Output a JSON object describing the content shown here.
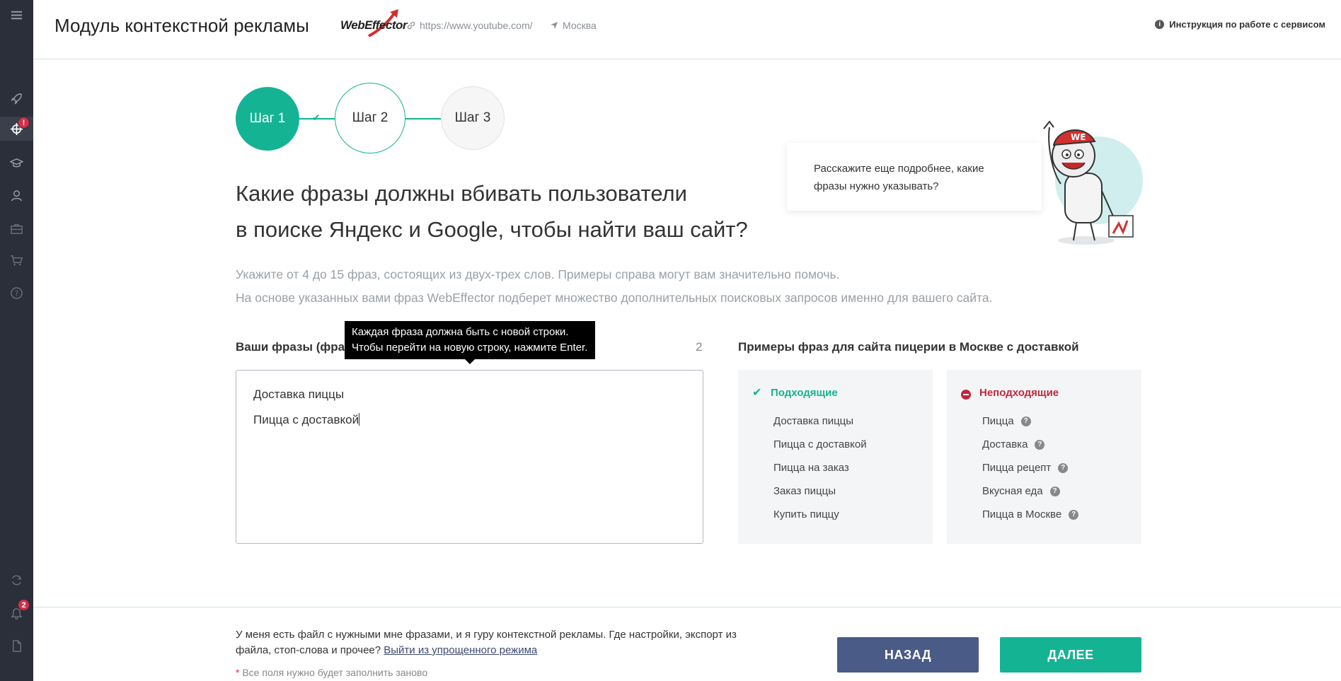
{
  "header": {
    "title": "Модуль контекстной рекламы",
    "logo_text": "WebEffector",
    "url": "https://www.youtube.com/",
    "region": "Москва",
    "instruction": "Инструкция по работе с сервисом"
  },
  "sidebar": {
    "targets_badge": "!",
    "notifications_badge": "2"
  },
  "steps": [
    "Шаг 1",
    "Шаг 2",
    "Шаг 3"
  ],
  "question": {
    "line1": "Какие фразы должны вбивать пользователи",
    "line2": "в поиске Яндекс и Google, чтобы найти ваш сайт?"
  },
  "hint": {
    "line1": "Укажите от 4 до 15 фраз, состоящих из двух-трех слов. Примеры справа могут вам значительно помочь.",
    "line2": "На основе указанных вами фраз WebEffector подберет множество дополнительных поисковых запросов именно для вашего сайта."
  },
  "bubble_text": "Расскажите еще подробнее, какие фразы нужно указывать?",
  "phrases": {
    "label": "Ваши фразы (фраз",
    "count": "2",
    "lines": [
      "Доставка пиццы",
      "Пицца с доставкой"
    ],
    "tooltip_line1": "Каждая фраза должна быть с новой строки.",
    "tooltip_line2": "Чтобы перейти на новую строку, нажмите Enter."
  },
  "examples": {
    "label": "Примеры фраз для сайта пицерии в Москве с доставкой",
    "good_title": "Подходящие",
    "good": [
      "Доставка пиццы",
      "Пицца с доставкой",
      "Пицца на заказ",
      "Заказ пиццы",
      "Купить пиццу"
    ],
    "bad_title": "Неподходящие",
    "bad": [
      "Пицца",
      "Доставка",
      "Пицца рецепт",
      "Вкусная еда",
      "Пицца в Москве"
    ]
  },
  "footer": {
    "text": "У меня есть файл с нужными мне фразами, и я гуру контекстной рекламы. Где настройки, экспорт из файла, стоп-слова и прочее? ",
    "link": "Выйти из упрощенного режима",
    "note_star": "*",
    "note": " Все поля нужно будет заполнить заново",
    "back_label": "НАЗАД",
    "next_label": "ДАЛЕЕ"
  },
  "colors": {
    "accent": "#14b394",
    "back_button": "#4a5b87",
    "danger": "#c0273e",
    "sidebar_bg": "#2b2f3a"
  }
}
